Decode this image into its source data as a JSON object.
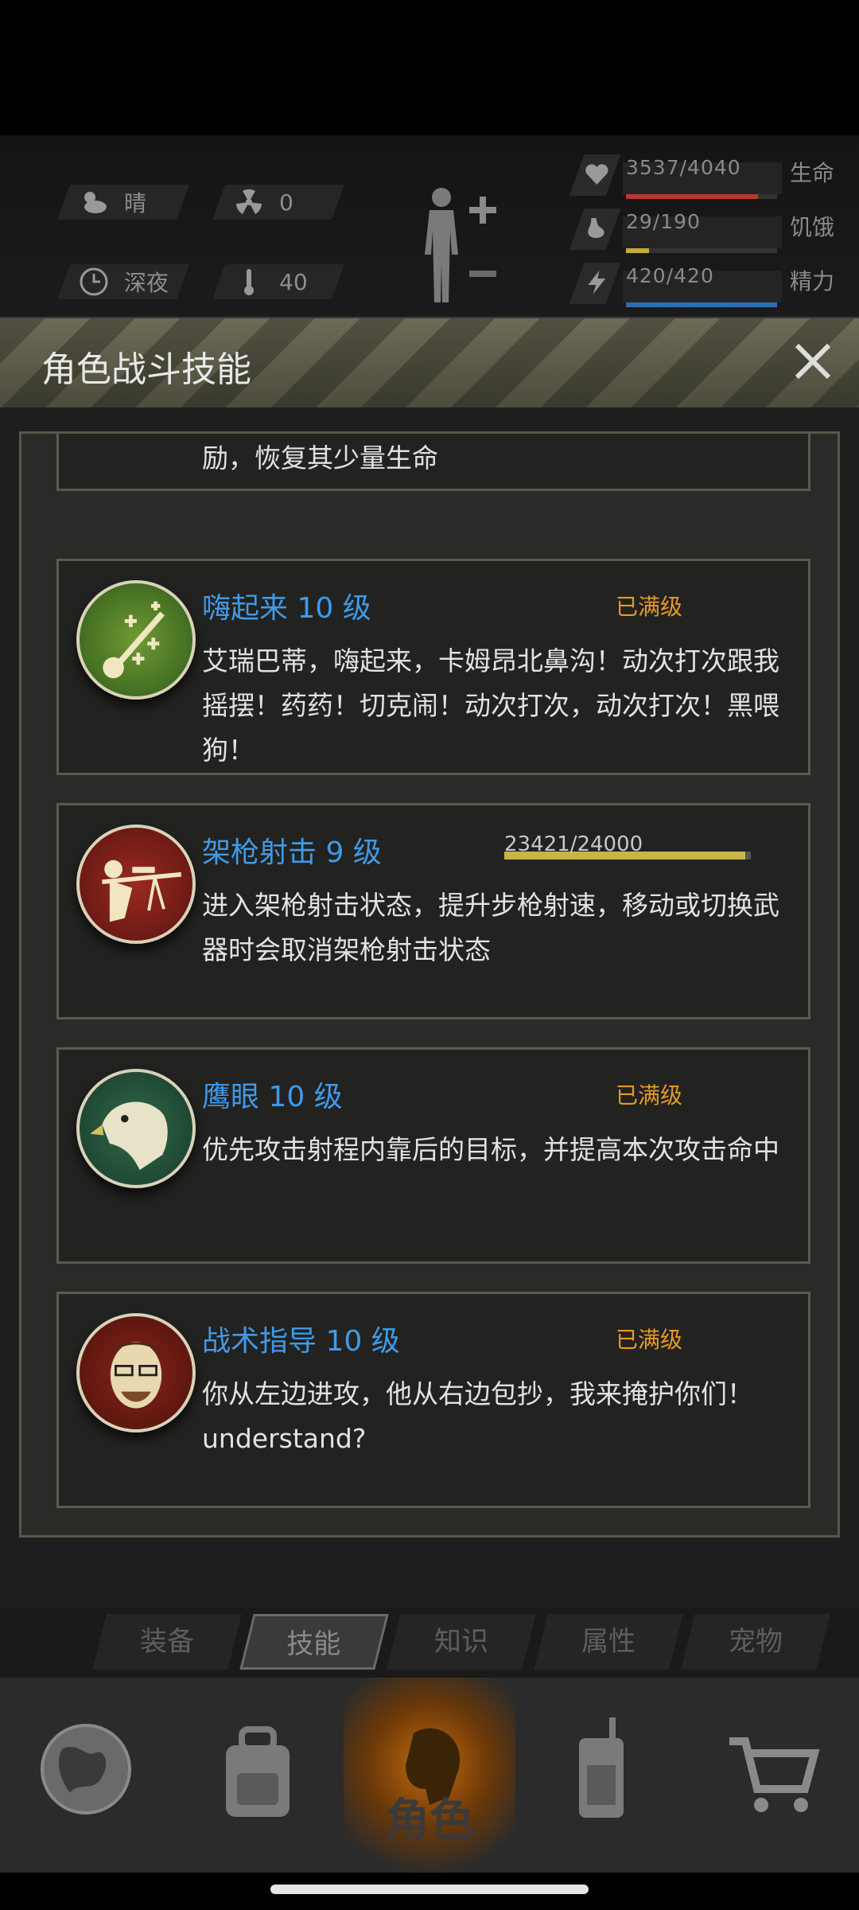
{
  "hud": {
    "weather": "晴",
    "radiation": "0",
    "time_of_day": "深夜",
    "temperature": "40",
    "stats": [
      {
        "name": "生命",
        "value_text": "3537/4040",
        "fraction": 0.875,
        "color": "#b83a2a",
        "icon": "heart-pulse-icon"
      },
      {
        "name": "饥饿",
        "value_text": "29/190",
        "fraction": 0.15,
        "color": "#c7a83a",
        "icon": "stomach-icon"
      },
      {
        "name": "精力",
        "value_text": "420/420",
        "fraction": 1.0,
        "color": "#2c6fb0",
        "icon": "lightning-icon"
      }
    ]
  },
  "panel": {
    "title": "角色战斗技能",
    "skills": [
      {
        "name": "",
        "status": "",
        "desc": "励，恢复其少量生命",
        "icon": "partial-skill-icon"
      },
      {
        "name": "嗨起来 10 级",
        "status": "已满级",
        "desc": "艾瑞巴蒂，嗨起来，卡姆昂北鼻沟！动次打次跟我摇摆！药药！切克闹！动次打次，动次打次！黑喂狗！",
        "icon": "guitar-icon"
      },
      {
        "name": "架枪射击 9 级",
        "status": "",
        "xp_text": "23421/24000",
        "xp_fraction": 0.976,
        "desc": "进入架枪射击状态，提升步枪射速，移动或切换武器时会取消架枪射击状态",
        "icon": "sniper-icon"
      },
      {
        "name": "鹰眼 10 级",
        "status": "已满级",
        "desc": "优先攻击射程内靠后的目标，并提高本次攻击命中",
        "icon": "eagle-icon"
      },
      {
        "name": "战术指导 10 级",
        "status": "已满级",
        "desc": "你从左边进攻，他从右边包抄，我来掩护你们！understand?",
        "icon": "commander-icon"
      }
    ]
  },
  "subtabs": [
    "装备",
    "技能",
    "知识",
    "属性",
    "宠物"
  ],
  "active_subtab": "技能",
  "bottom_nav": {
    "items": [
      "globe-icon",
      "backpack-icon",
      "character-icon",
      "radio-icon",
      "cart-icon"
    ],
    "active_label": "角色"
  }
}
